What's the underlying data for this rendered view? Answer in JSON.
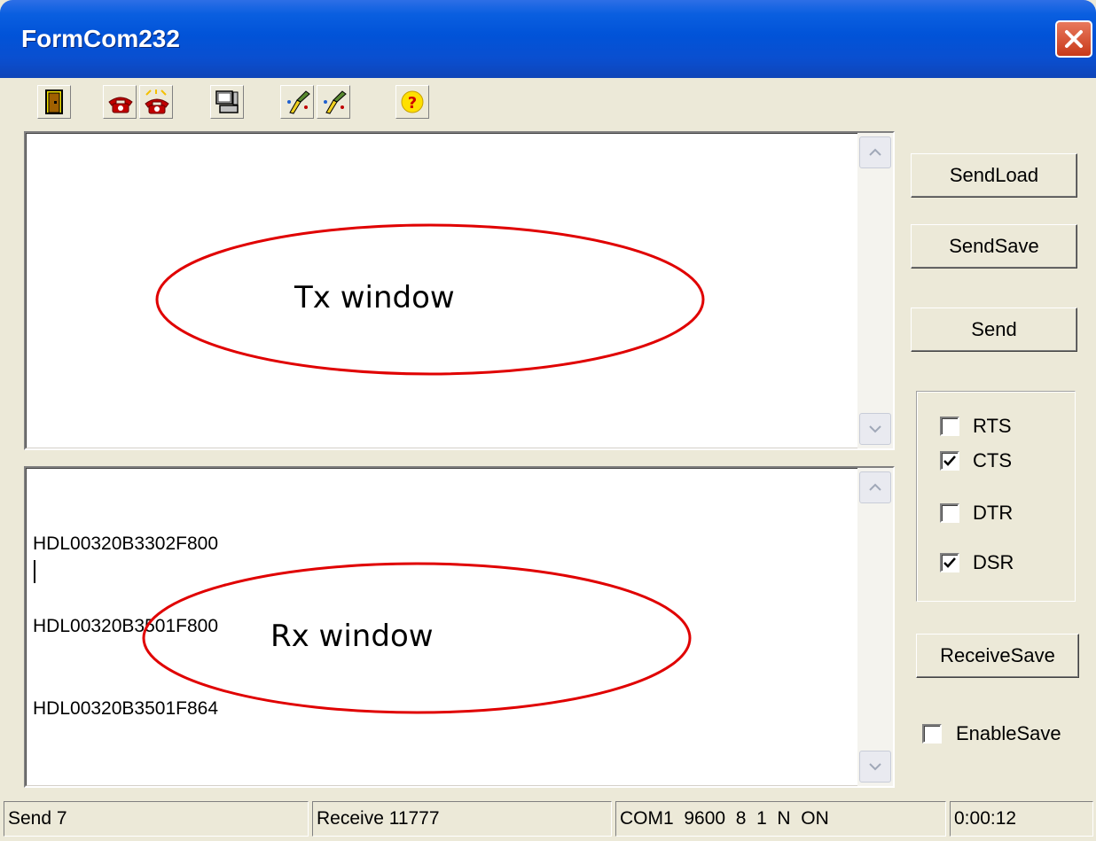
{
  "window": {
    "title": "FormCom232",
    "close_icon": "close-x-icon"
  },
  "toolbar": {
    "buttons": [
      {
        "name": "exit-door-icon"
      },
      {
        "name": "phone-connect-icon"
      },
      {
        "name": "phone-disconnect-icon"
      },
      {
        "name": "computer-settings-icon"
      },
      {
        "name": "brush-clear-tx-icon"
      },
      {
        "name": "brush-clear-rx-icon"
      },
      {
        "name": "help-question-icon"
      }
    ]
  },
  "tx_memo": {
    "annotation_label": "Tx window",
    "annotation_color": "#e00000"
  },
  "rx_memo": {
    "lines": [
      "HDL00320B3302F800",
      "HDL00320B3501F800",
      "HDL00320B3501F864"
    ],
    "annotation_label": "Rx window",
    "annotation_color": "#e00000"
  },
  "buttons": {
    "send_load": "SendLoad",
    "send_save": "SendSave",
    "send": "Send",
    "receive_save": "ReceiveSave"
  },
  "signals": {
    "rts": {
      "label": "RTS",
      "checked": false
    },
    "cts": {
      "label": "CTS",
      "checked": true
    },
    "dtr": {
      "label": "DTR",
      "checked": false
    },
    "dsr": {
      "label": "DSR",
      "checked": true
    }
  },
  "enable_save": {
    "label": "EnableSave",
    "checked": false
  },
  "status": {
    "send": "Send 7",
    "receive": "Receive 11777",
    "port": "COM1  9600  8  1  N  ON",
    "time": "0:00:12"
  }
}
